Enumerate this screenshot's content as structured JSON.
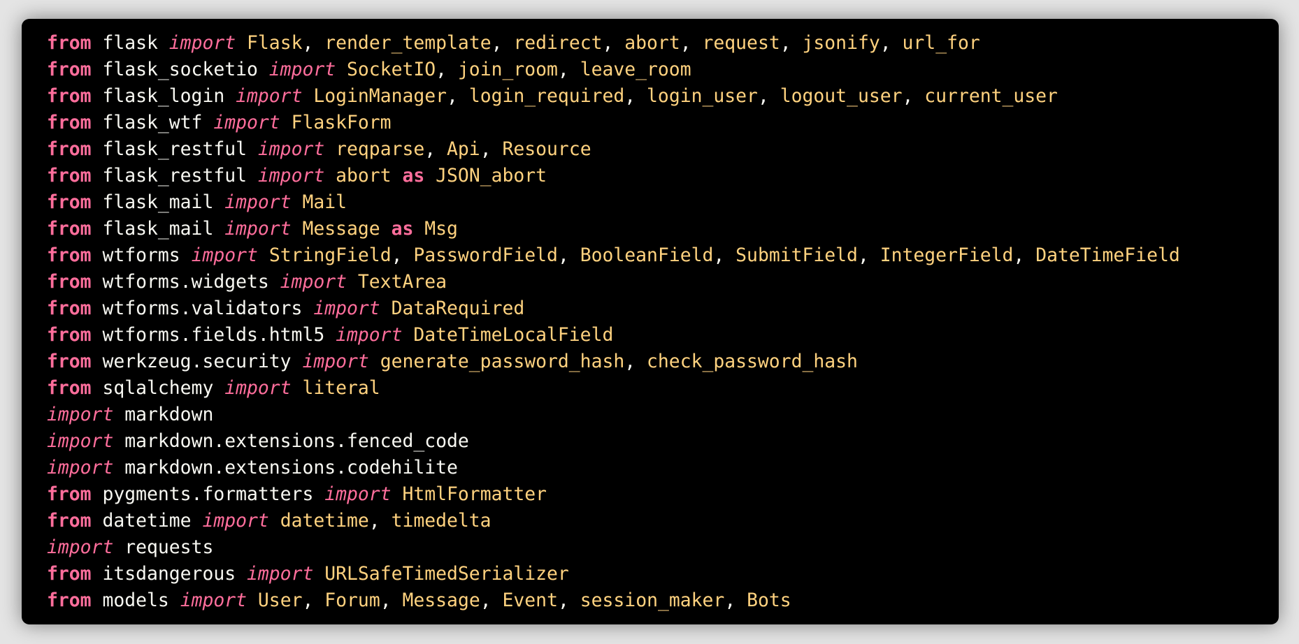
{
  "code_block": {
    "language": "python",
    "theme": {
      "background": "#000000",
      "page_background": "#e4e4e4",
      "keyword_color": "#ff6e9c",
      "module_color": "#f8f8f2",
      "name_color": "#ffd27f"
    },
    "lines": [
      {
        "kw": "from",
        "module": "flask",
        "names": [
          "Flask",
          "render_template",
          "redirect",
          "abort",
          "request",
          "jsonify",
          "url_for"
        ]
      },
      {
        "kw": "from",
        "module": "flask_socketio",
        "names": [
          "SocketIO",
          "join_room",
          "leave_room"
        ]
      },
      {
        "kw": "from",
        "module": "flask_login",
        "names": [
          "LoginManager",
          "login_required",
          "login_user",
          "logout_user",
          "current_user"
        ]
      },
      {
        "kw": "from",
        "module": "flask_wtf",
        "names": [
          "FlaskForm"
        ]
      },
      {
        "kw": "from",
        "module": "flask_restful",
        "names": [
          "reqparse",
          "Api",
          "Resource"
        ]
      },
      {
        "kw": "from",
        "module": "flask_restful",
        "names": [
          "abort"
        ],
        "as": "JSON_abort"
      },
      {
        "kw": "from",
        "module": "flask_mail",
        "names": [
          "Mail"
        ]
      },
      {
        "kw": "from",
        "module": "flask_mail",
        "names": [
          "Message"
        ],
        "as": "Msg"
      },
      {
        "kw": "from",
        "module": "wtforms",
        "names": [
          "StringField",
          "PasswordField",
          "BooleanField",
          "SubmitField",
          "IntegerField",
          "DateTimeField"
        ]
      },
      {
        "kw": "from",
        "module": "wtforms.widgets",
        "names": [
          "TextArea"
        ]
      },
      {
        "kw": "from",
        "module": "wtforms.validators",
        "names": [
          "DataRequired"
        ]
      },
      {
        "kw": "from",
        "module": "wtforms.fields.html5",
        "names": [
          "DateTimeLocalField"
        ]
      },
      {
        "kw": "from",
        "module": "werkzeug.security",
        "names": [
          "generate_password_hash",
          "check_password_hash"
        ]
      },
      {
        "kw": "from",
        "module": "sqlalchemy",
        "names": [
          "literal"
        ]
      },
      {
        "kw": "import",
        "module": "markdown"
      },
      {
        "kw": "import",
        "module": "markdown.extensions.fenced_code"
      },
      {
        "kw": "import",
        "module": "markdown.extensions.codehilite"
      },
      {
        "kw": "from",
        "module": "pygments.formatters",
        "names": [
          "HtmlFormatter"
        ]
      },
      {
        "kw": "from",
        "module": "datetime",
        "names": [
          "datetime",
          "timedelta"
        ]
      },
      {
        "kw": "import",
        "module": "requests"
      },
      {
        "kw": "from",
        "module": "itsdangerous",
        "names": [
          "URLSafeTimedSerializer"
        ]
      },
      {
        "kw": "from",
        "module": "models",
        "names": [
          "User",
          "Forum",
          "Message",
          "Event",
          "session_maker",
          "Bots"
        ]
      }
    ]
  }
}
